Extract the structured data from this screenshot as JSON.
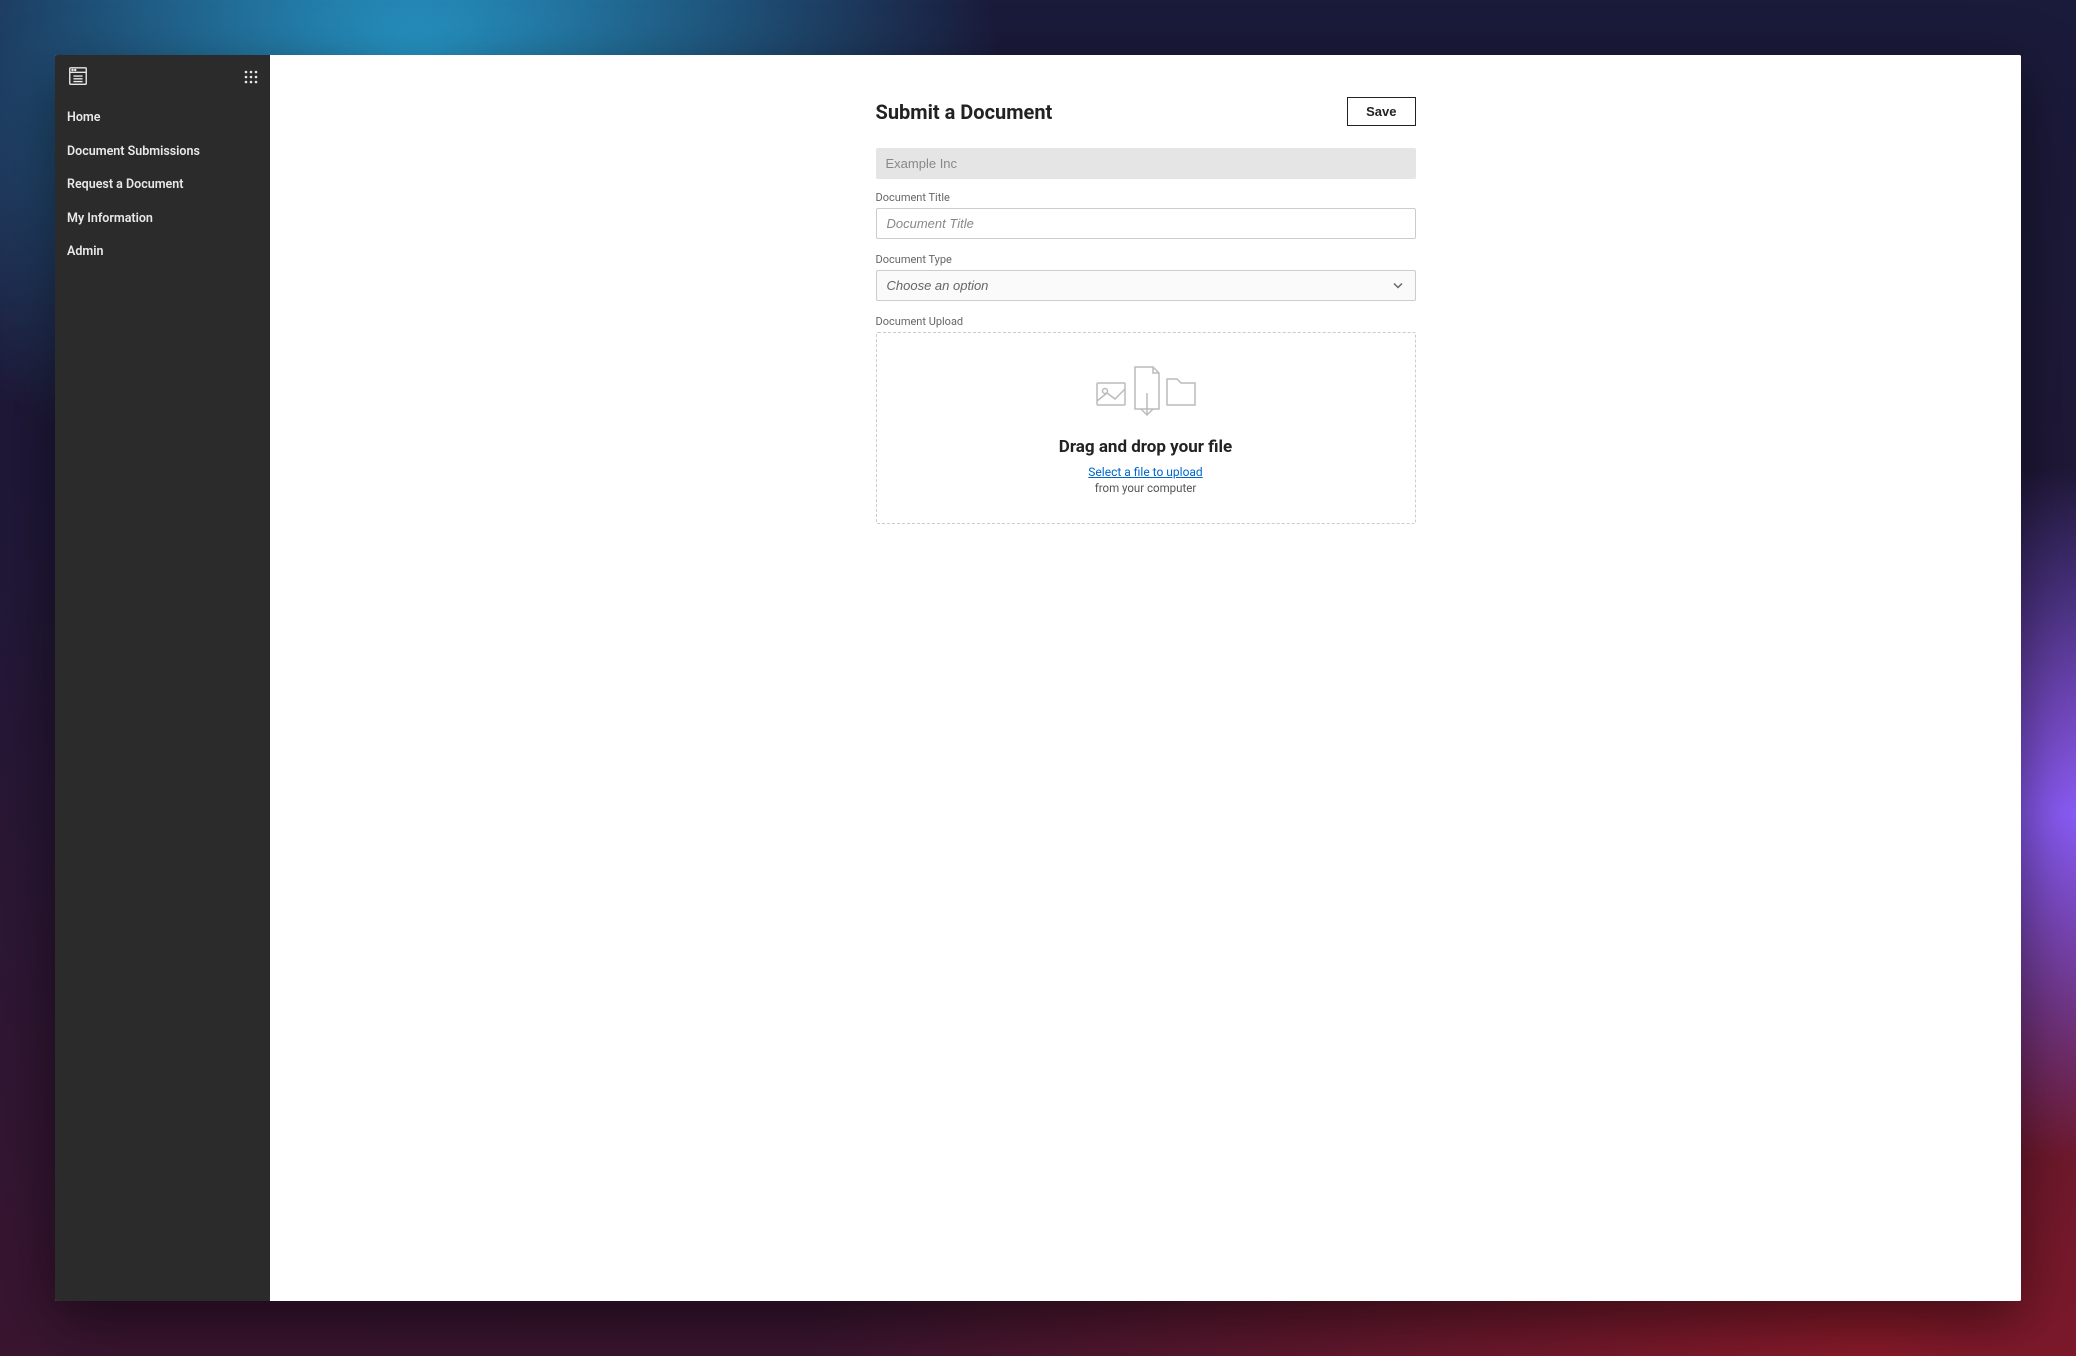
{
  "sidebar": {
    "items": [
      {
        "label": "Home"
      },
      {
        "label": "Document Submissions"
      },
      {
        "label": "Request a Document"
      },
      {
        "label": "My Information"
      },
      {
        "label": "Admin"
      }
    ]
  },
  "header": {
    "title": "Submit a Document",
    "save_label": "Save"
  },
  "form": {
    "company_value": "Example Inc",
    "doc_title_label": "Document Title",
    "doc_title_placeholder": "Document Title",
    "doc_type_label": "Document Type",
    "doc_type_placeholder": "Choose an option",
    "upload_label": "Document Upload",
    "upload_title": "Drag and drop your file",
    "upload_link": "Select a file to upload",
    "upload_sub": "from your computer"
  }
}
